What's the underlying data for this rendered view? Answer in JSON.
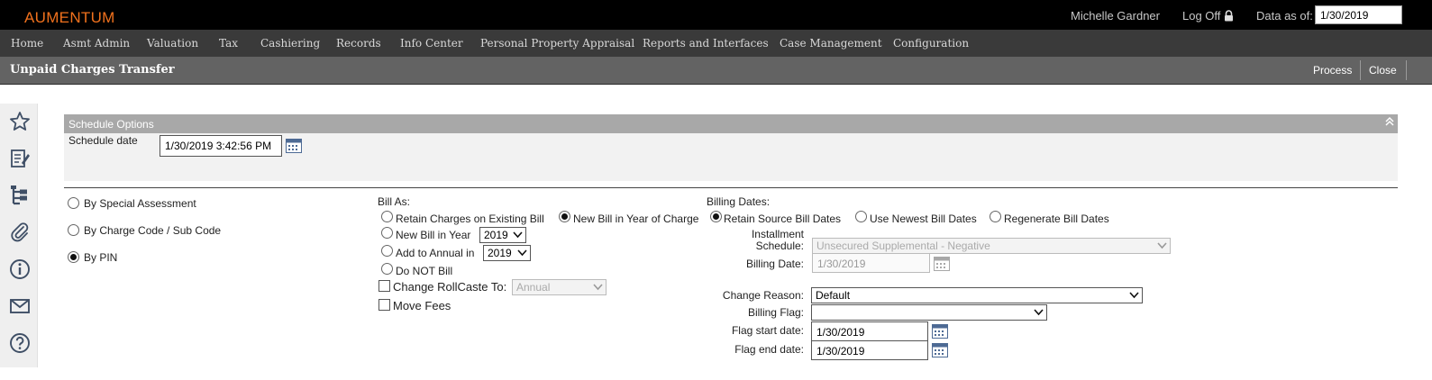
{
  "app": {
    "brand": "AUMENTUM",
    "user": "Michelle Gardner",
    "logoff": "Log Off",
    "data_as_of_label": "Data as of:",
    "data_as_of": "1/30/2019"
  },
  "menu": [
    "Home",
    "Asmt Admin",
    "Valuation",
    "Tax",
    "Cashiering",
    "Records",
    "Info Center",
    "Personal Property Appraisal",
    "Reports and Interfaces",
    "Case Management",
    "Configuration"
  ],
  "page": {
    "title": "Unpaid Charges Transfer",
    "process": "Process",
    "close": "Close"
  },
  "sidebar": [
    "star-icon",
    "edit-document-icon",
    "hierarchy-icon",
    "paperclip-icon",
    "info-icon",
    "mail-icon",
    "help-icon"
  ],
  "schedule": {
    "title": "Schedule Options",
    "date_label": "Schedule date",
    "date_value": "1/30/2019 3:42:56 PM"
  },
  "selection": {
    "by_special_assessment": "By Special Assessment",
    "by_charge_code": "By Charge Code / Sub Code",
    "by_pin": "By PIN",
    "selected": "by_pin"
  },
  "bill_as": {
    "label": "Bill As:",
    "retain_existing": "Retain Charges on Existing Bill",
    "new_bill_year_of_charge": "New Bill in Year of Charge",
    "new_bill_in_year": "New Bill in Year",
    "new_bill_year_value": "2019",
    "add_to_annual": "Add to Annual in",
    "add_to_annual_value": "2019",
    "do_not_bill": "Do NOT Bill",
    "change_rollcaste": "Change RollCaste To:",
    "rollcaste_value": "Annual",
    "move_fees": "Move Fees",
    "selected": "new_bill_year_of_charge"
  },
  "billing_dates": {
    "label": "Billing Dates:",
    "retain_source": "Retain Source Bill Dates",
    "use_newest": "Use Newest Bill Dates",
    "regenerate": "Regenerate Bill Dates",
    "selected": "retain_source",
    "installment_label_1": "Installment",
    "installment_label_2": "Schedule:",
    "installment_value": "Unsecured Supplemental - Negative",
    "billing_date_label": "Billing Date:",
    "billing_date_value": "1/30/2019"
  },
  "flags": {
    "change_reason_label": "Change Reason:",
    "change_reason_value": "Default",
    "billing_flag_label": "Billing Flag:",
    "billing_flag_value": "",
    "flag_start_label": "Flag start date:",
    "flag_start_value": "1/30/2019",
    "flag_end_label": "Flag end date:",
    "flag_end_value": "1/30/2019"
  },
  "colors": {
    "brand": "#f0711d",
    "topbar": "#000000",
    "menubar": "#3a3a3a",
    "titlebar": "#636363",
    "section_header": "#a8a8a8"
  }
}
